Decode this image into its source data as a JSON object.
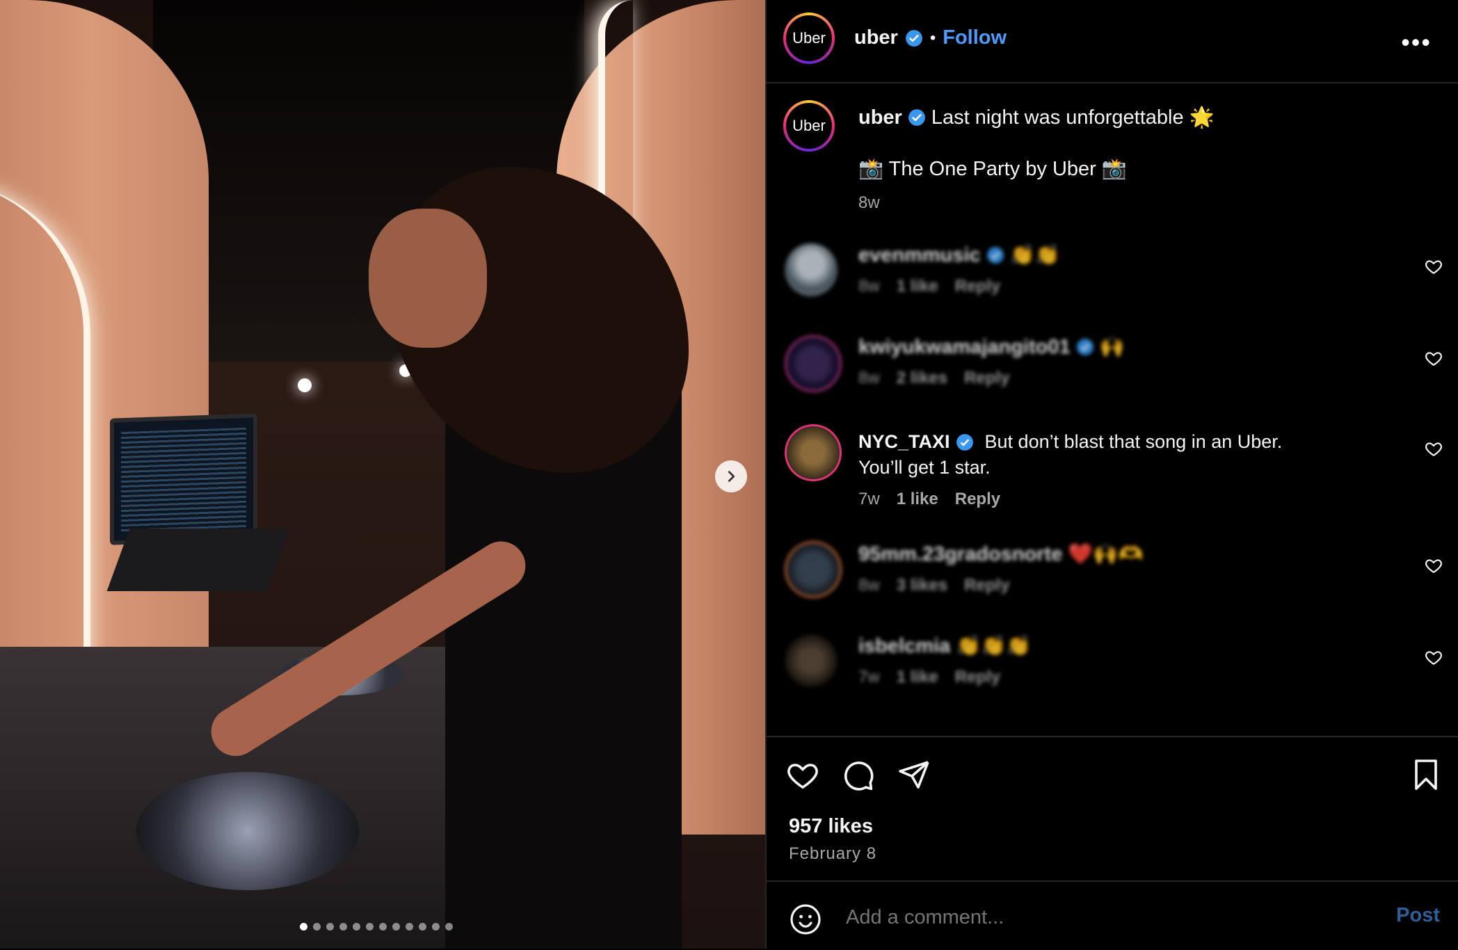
{
  "post": {
    "account": "uber",
    "avatar_text": "Uber",
    "follow_label": "Follow",
    "more_label": "•••",
    "caption_line1": "Last night was unforgettable 🌟",
    "caption_line2": "📸 The One Party by Uber 📸",
    "caption_time": "8w",
    "carousel_dots": 12,
    "carousel_active": 0,
    "likes": "957 likes",
    "date": "February 8"
  },
  "comments": [
    {
      "user": "evenmmusic",
      "verified": true,
      "text": "👏👏",
      "time": "8w",
      "likes": "1 like",
      "reply": "Reply",
      "blurred": true
    },
    {
      "user": "kwiyukwamajangito01",
      "verified": true,
      "text": "🙌",
      "time": "8w",
      "likes": "2 likes",
      "reply": "Reply",
      "blurred": true
    },
    {
      "user": "NYC_TAXI",
      "verified": true,
      "text": "But don’t blast that song in an Uber.",
      "text2": "You’ll get 1 star.",
      "time": "7w",
      "likes": "1 like",
      "reply": "Reply",
      "blurred": false
    },
    {
      "user": "95mm.23gradosnorte",
      "verified": false,
      "text": "❤️🙌🫶",
      "time": "8w",
      "likes": "3 likes",
      "reply": "Reply",
      "blurred": true
    },
    {
      "user": "isbelcmia",
      "verified": false,
      "text": "👏👏👏",
      "time": "7w",
      "likes": "1 like",
      "reply": "Reply",
      "blurred": true
    }
  ],
  "add_comment": {
    "placeholder": "Add a comment...",
    "post_label": "Post"
  },
  "colors": {
    "link_blue": "#4c9bff",
    "verified_blue": "#3897f0",
    "muted": "#a8a8a8",
    "post_disabled": "#2e5f96"
  },
  "icons": [
    "chevron-right-icon",
    "more-icon",
    "verified-icon",
    "heart-icon",
    "comment-icon",
    "share-icon",
    "bookmark-icon",
    "emoji-icon"
  ]
}
